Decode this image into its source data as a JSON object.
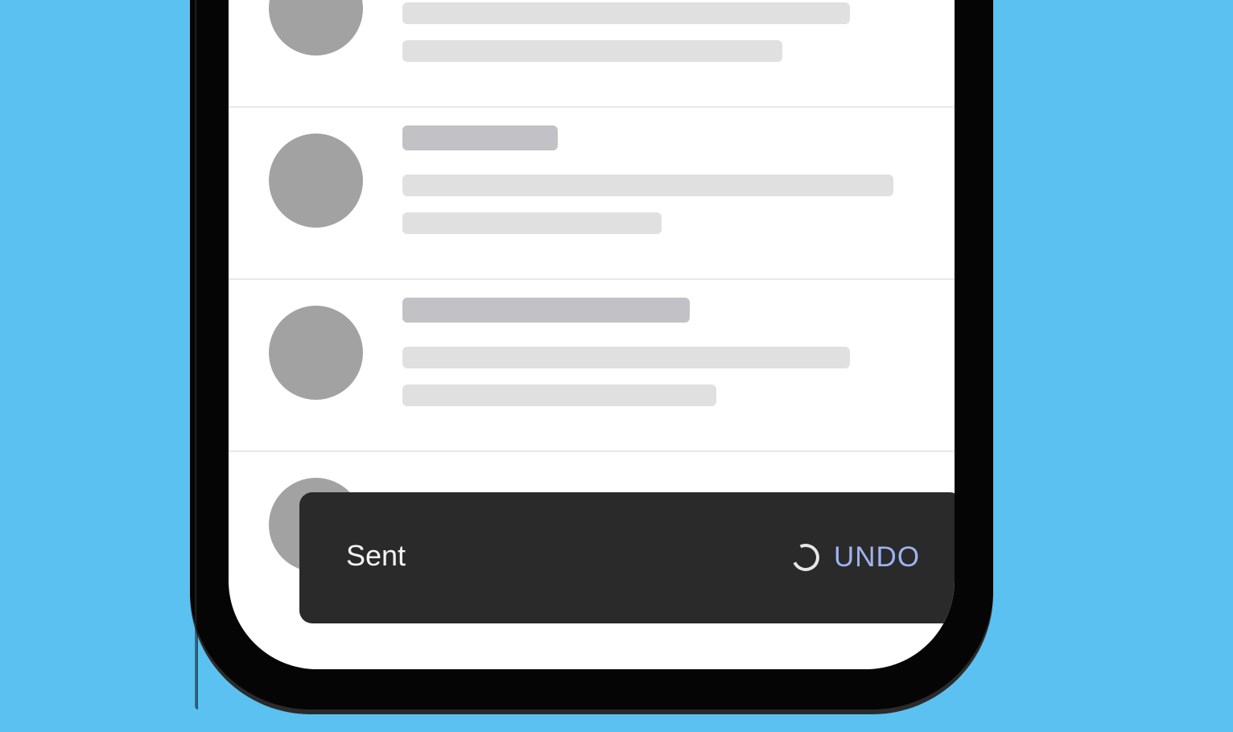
{
  "colors": {
    "background": "#5bc1f0",
    "phone_frame": "#050505",
    "screen": "#ffffff",
    "avatar_placeholder": "#a2a2a2",
    "title_placeholder": "#c2c2c6",
    "line_placeholder": "#e0e0e0",
    "snackbar_background": "#2a2a2a",
    "snackbar_text": "#f4f4f4",
    "undo_accent": "#9db3f0"
  },
  "snackbar": {
    "message": "Sent",
    "action_label": "UNDO",
    "spinner_icon": "loading-spinner-icon"
  }
}
